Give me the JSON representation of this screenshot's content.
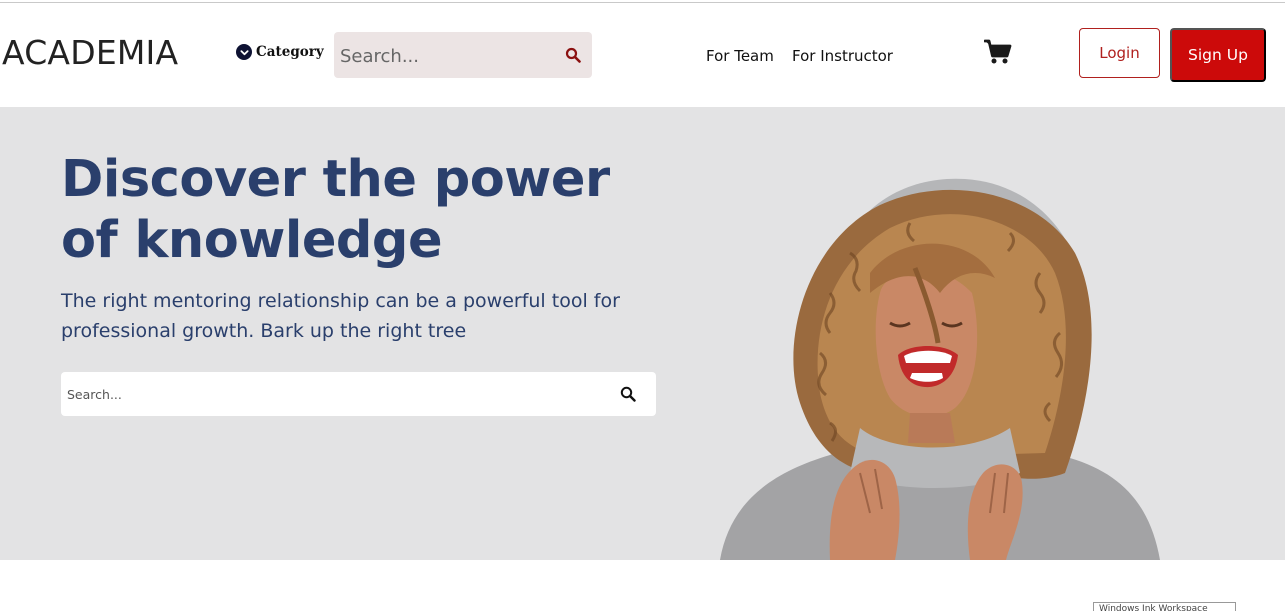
{
  "header": {
    "logo": "ACADEMIA",
    "category_label": "Category",
    "search_placeholder": "Search...",
    "nav_links": [
      "For Team",
      "For Instructor"
    ],
    "login_label": "Login",
    "signup_label": "Sign Up"
  },
  "hero": {
    "title": "Discover the power of knowledge",
    "subtitle": "The right mentoring relationship can be a powerful tool for professional growth. Bark up the right tree",
    "search_placeholder": "Search..."
  },
  "taskbar_tooltip": "Windows Ink Workspace",
  "icons": {
    "category": "chevron-down-circle-icon",
    "nav_search": "search-icon",
    "cart": "shopping-cart-icon",
    "hero_search": "search-icon"
  },
  "colors": {
    "brand_red": "#cc0a0a",
    "login_border": "#b0201e",
    "hero_bg": "#e3e3e4",
    "hero_text": "#2a3f6c",
    "nav_search_bg": "#ece4e4"
  }
}
